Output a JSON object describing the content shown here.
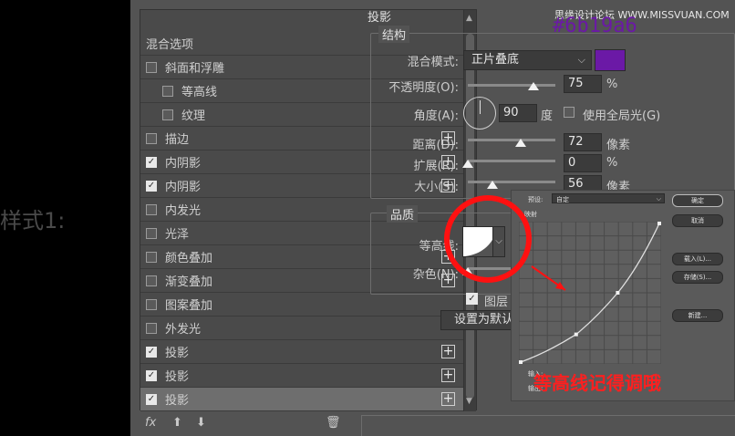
{
  "left_caption": "样式1:",
  "watermark": "思缘设计论坛 WWW.MISSVUAN.COM",
  "hex_label": "#6b19a6",
  "colors": {
    "shadow_swatch": "#6b19a6",
    "annotation": "#ff1f1f",
    "circle": "#ff1111"
  },
  "style_list": {
    "header": "混合选项",
    "items": [
      {
        "label": "斜面和浮雕",
        "checked": false,
        "indent": false,
        "plus": false
      },
      {
        "label": "等高线",
        "checked": false,
        "indent": true,
        "plus": false
      },
      {
        "label": "纹理",
        "checked": false,
        "indent": true,
        "plus": false
      },
      {
        "label": "描边",
        "checked": false,
        "indent": false,
        "plus": true
      },
      {
        "label": "内阴影",
        "checked": true,
        "indent": false,
        "plus": true
      },
      {
        "label": "内阴影",
        "checked": true,
        "indent": false,
        "plus": true
      },
      {
        "label": "内发光",
        "checked": false,
        "indent": false,
        "plus": false
      },
      {
        "label": "光泽",
        "checked": false,
        "indent": false,
        "plus": false
      },
      {
        "label": "颜色叠加",
        "checked": false,
        "indent": false,
        "plus": true
      },
      {
        "label": "渐变叠加",
        "checked": false,
        "indent": false,
        "plus": true
      },
      {
        "label": "图案叠加",
        "checked": false,
        "indent": false,
        "plus": false
      },
      {
        "label": "外发光",
        "checked": false,
        "indent": false,
        "plus": false
      },
      {
        "label": "投影",
        "checked": true,
        "indent": false,
        "plus": true
      },
      {
        "label": "投影",
        "checked": true,
        "indent": false,
        "plus": true
      },
      {
        "label": "投影",
        "checked": true,
        "indent": false,
        "plus": true,
        "selected": true
      }
    ],
    "footer": {
      "fx": "fx",
      "up": "⬆",
      "down": "⬇",
      "trash": "🗑"
    }
  },
  "drop_shadow": {
    "title": "投影",
    "structure": {
      "title": "结构",
      "blend_mode_label": "混合模式:",
      "blend_mode": "正片叠底",
      "opacity_label": "不透明度(O):",
      "opacity": "75",
      "opacity_unit": "%",
      "angle_label": "角度(A):",
      "angle": "90",
      "angle_unit": "度",
      "global_light_label": "使用全局光(G)",
      "distance_label": "距离(D):",
      "distance": "72",
      "distance_unit": "像素",
      "spread_label": "扩展(R):",
      "spread": "0",
      "spread_unit": "%",
      "size_label": "大小(S):",
      "size": "56",
      "size_unit": "像素"
    },
    "quality": {
      "title": "品质",
      "contour_label": "等高线:",
      "noise_label": "杂色(N):",
      "layer_knockout_label": "图层",
      "set_default_label": "设置为默认"
    },
    "slider_levels": {
      "opacity": 0.75,
      "distance": 0.6,
      "spread": 0,
      "size": 0.28,
      "noise": 0
    }
  },
  "curve_popup": {
    "preset_label": "预设:",
    "preset_value": "自定",
    "mapping_label": "映射",
    "ok": "确定",
    "cancel": "取消",
    "load": "载入(L)...",
    "save": "存储(S)...",
    "new": "新建...",
    "input_label": "输入:",
    "output_label": "输出:",
    "curve_points": [
      [
        0,
        0
      ],
      [
        0.4,
        0.2
      ],
      [
        0.7,
        0.5
      ],
      [
        1,
        1
      ]
    ]
  },
  "annotation": "等高线记得调哦"
}
